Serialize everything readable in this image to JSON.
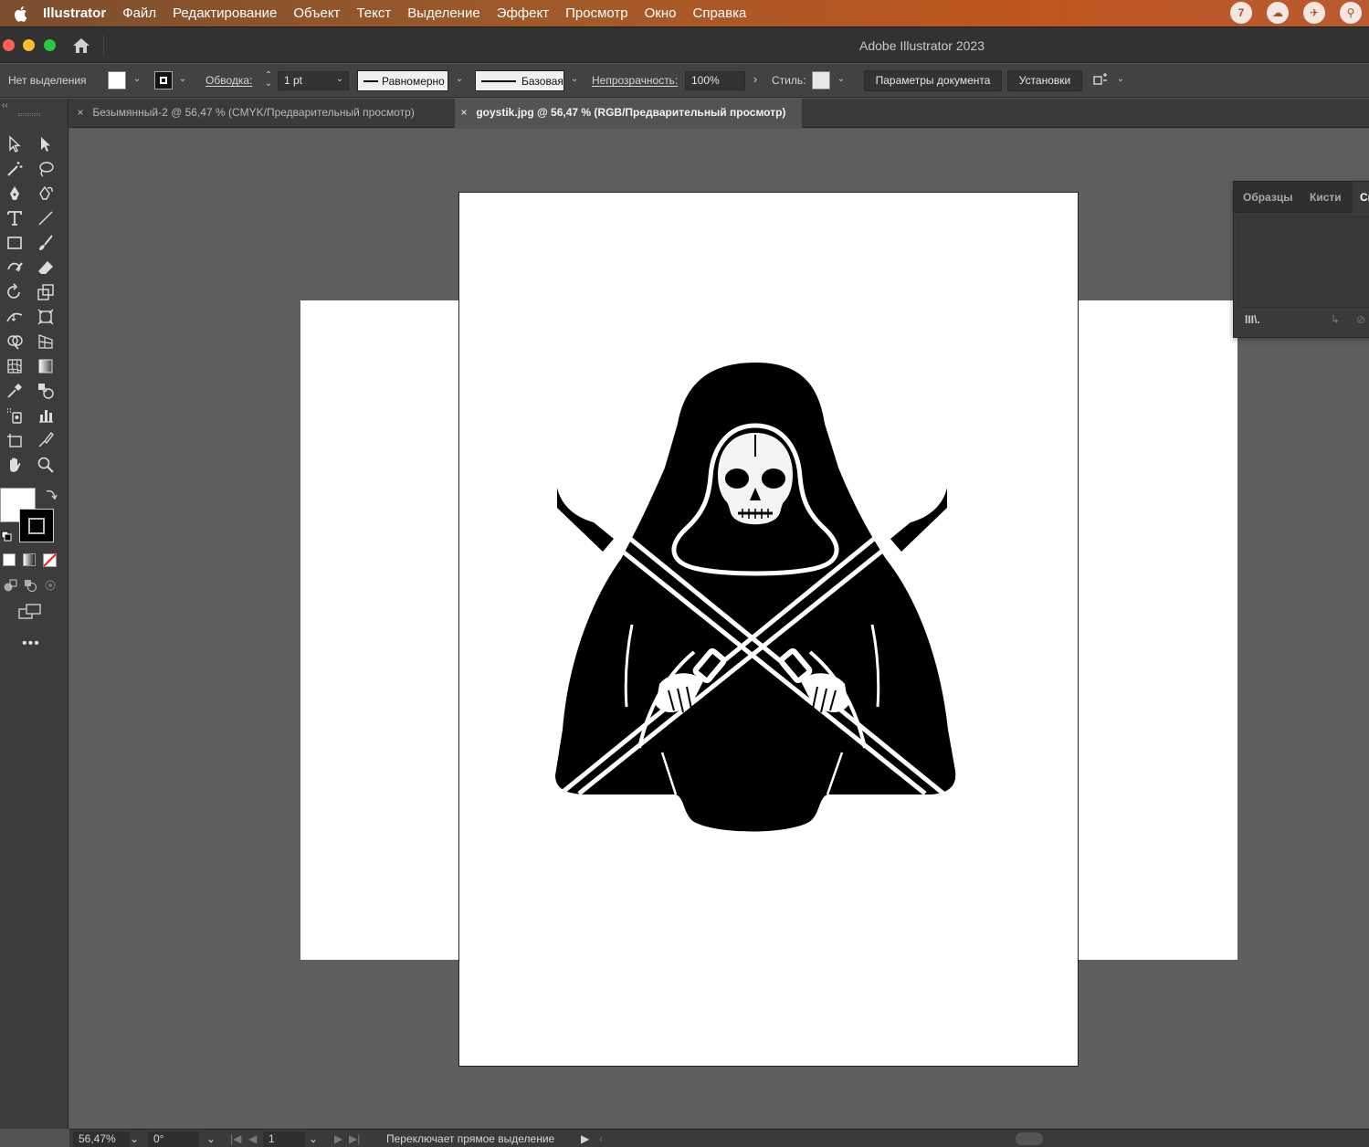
{
  "menubar": {
    "app_name": "Illustrator",
    "items": [
      "Файл",
      "Редактирование",
      "Объект",
      "Текст",
      "Выделение",
      "Эффект",
      "Просмотр",
      "Окно",
      "Справка"
    ],
    "tray": [
      "7",
      "☁",
      "✈",
      "⚲"
    ]
  },
  "window": {
    "title": "Adobe Illustrator 2023"
  },
  "control_bar": {
    "selection_state": "Нет выделения",
    "stroke_label": "Обводка:",
    "stroke_weight": "1 pt",
    "profile_label": "Равномерно",
    "brush_label": "Базовая",
    "opacity_label": "Непрозрачность:",
    "opacity_value": "100%",
    "style_label": "Стиль:",
    "doc_setup_button": "Параметры документа",
    "preferences_button": "Установки"
  },
  "tabs": [
    {
      "label": "Безымянный-2 @ 56,47 % (CMYK/Предварительный просмотр)",
      "active": false
    },
    {
      "label": "goystik.jpg @ 56,47 % (RGB/Предварительный просмотр)",
      "active": true
    }
  ],
  "panel": {
    "tabs": [
      "Образцы",
      "Кисти",
      "Си"
    ],
    "library_icon": "lII\\."
  },
  "status_bar": {
    "zoom": "56,47%",
    "rotation": "0°",
    "artboard_number": "1",
    "status_text": "Переключает прямое выделение"
  },
  "colors": {
    "accent": "#c0561f",
    "canvas": "#5f5f5f",
    "ui_dark": "#3c3c3c"
  }
}
